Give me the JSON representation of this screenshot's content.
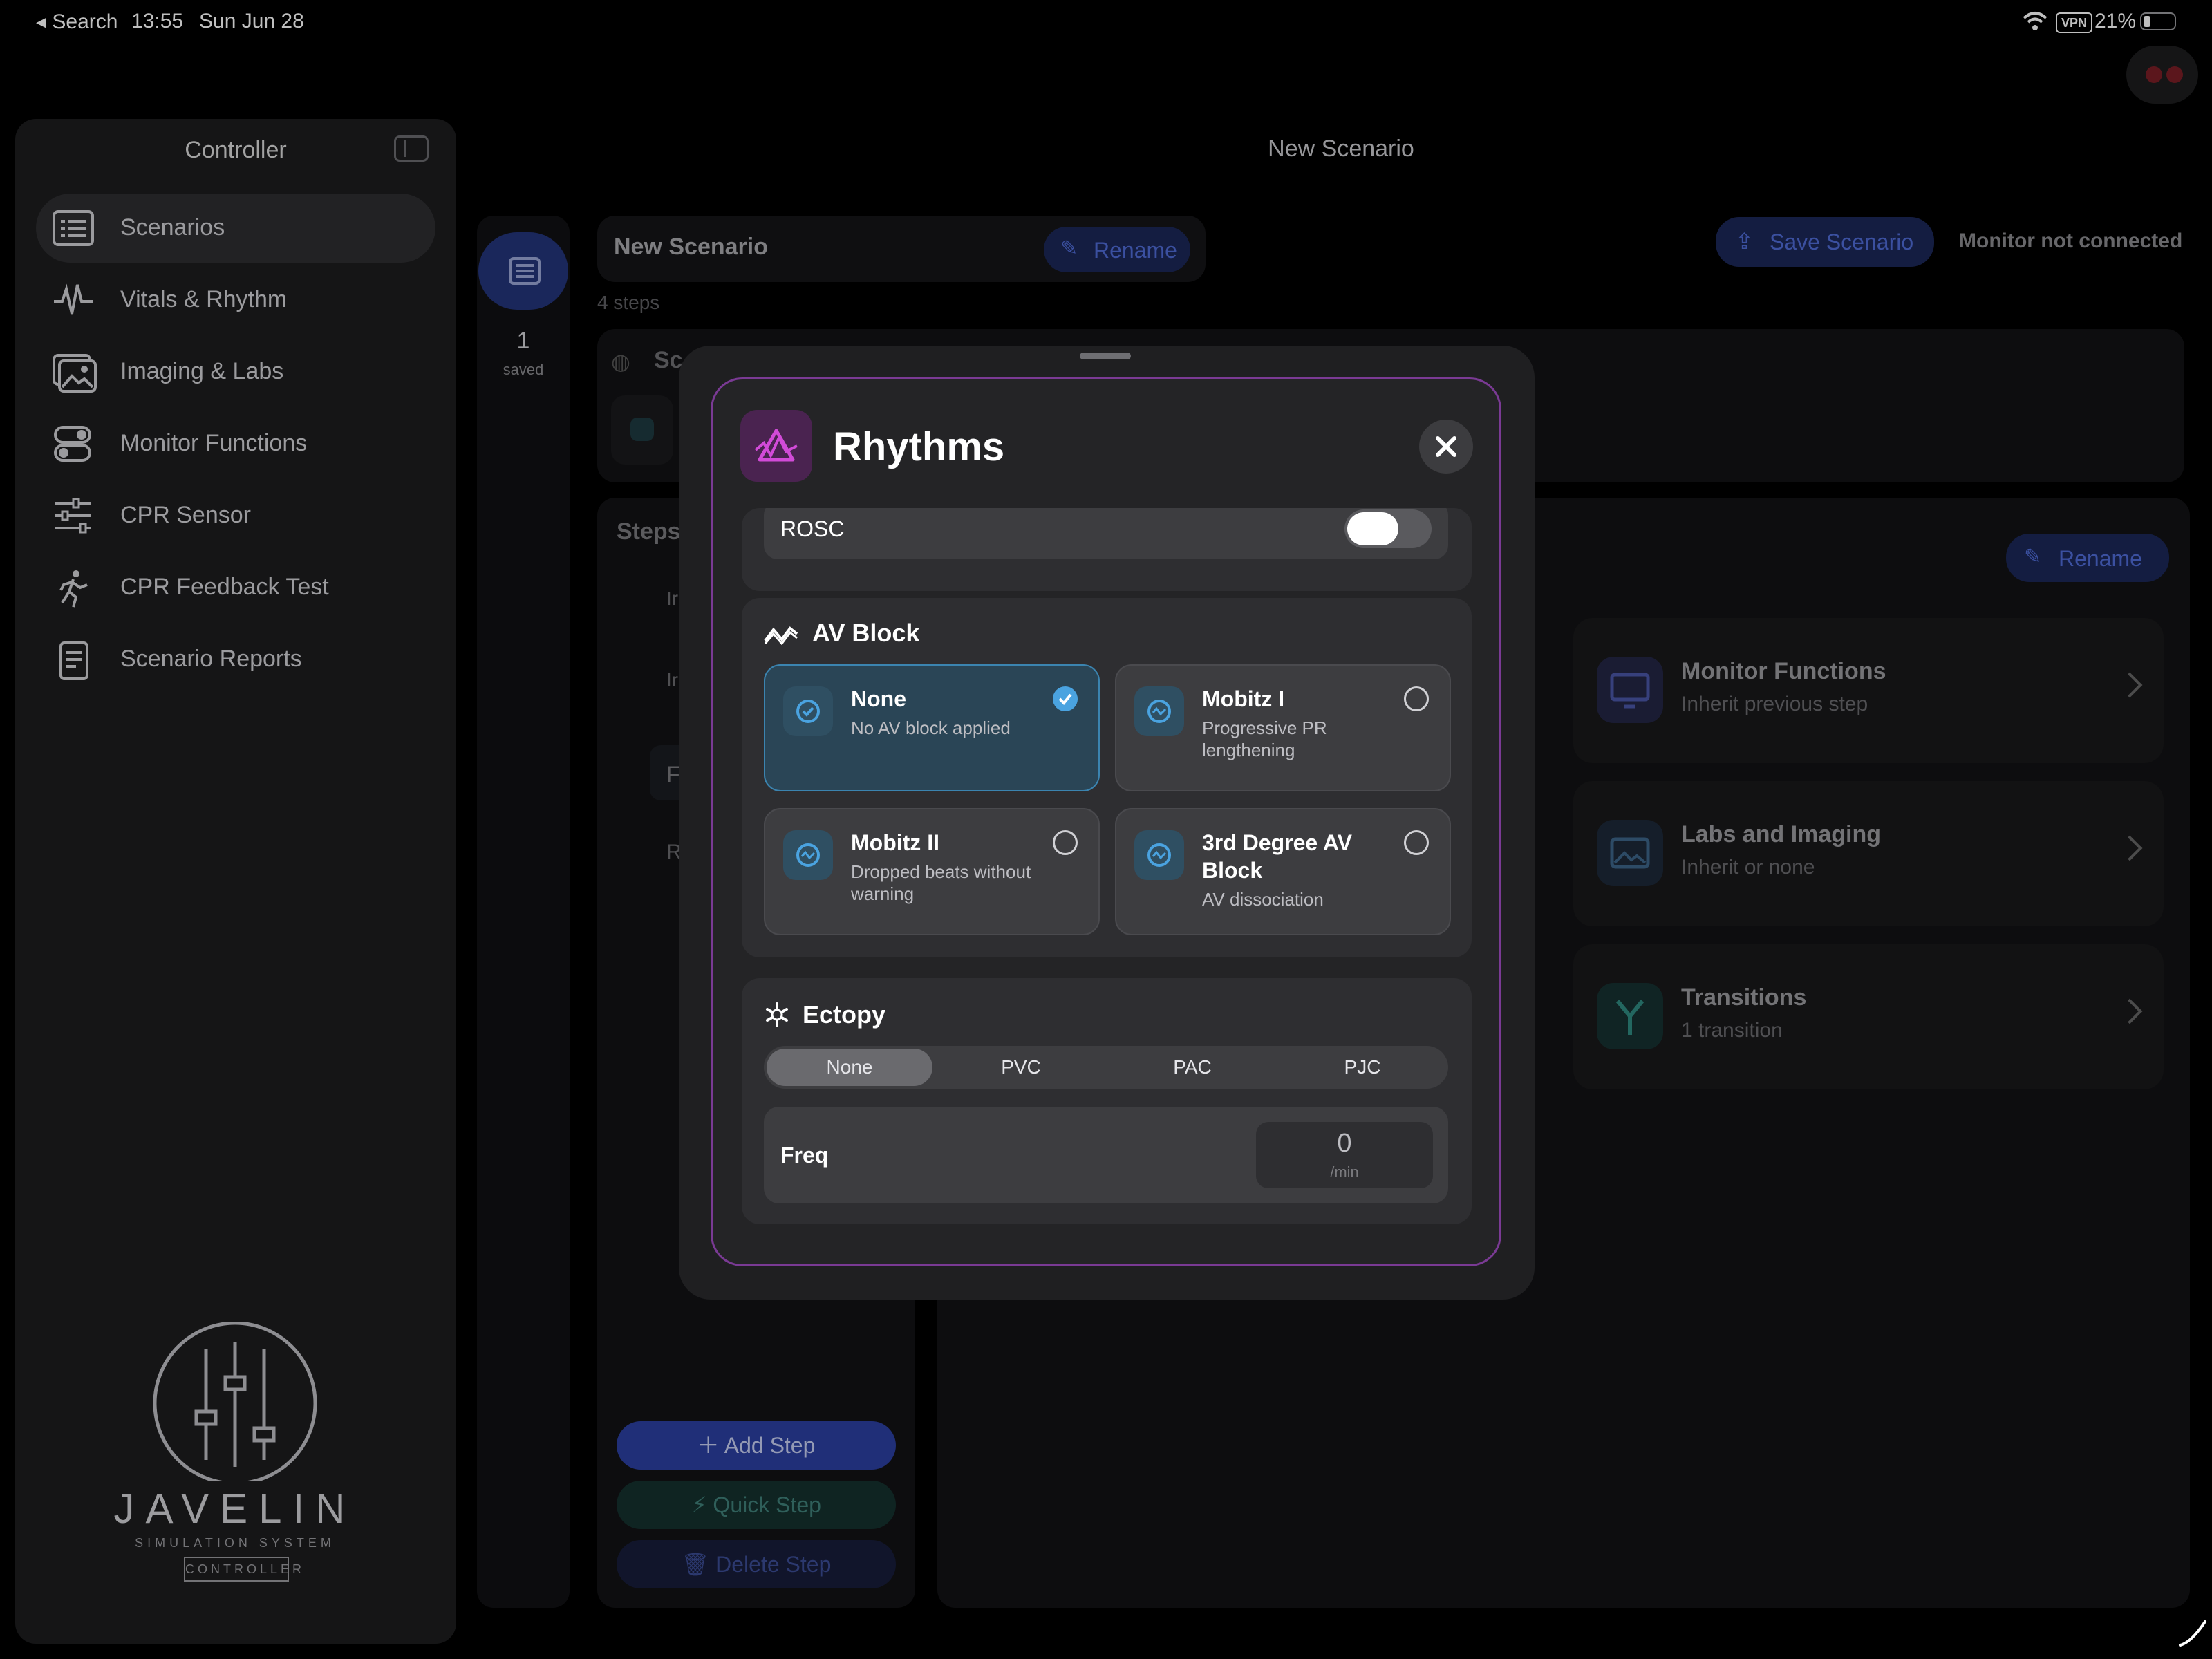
{
  "status_bar": {
    "back_label": "◂ Search",
    "time": "13:55",
    "date": "Sun Jun 28",
    "vpn": "VPN",
    "battery": "21%"
  },
  "sidebar": {
    "title": "Controller",
    "items": [
      {
        "label": "Scenarios",
        "selected": true
      },
      {
        "label": "Vitals & Rhythm"
      },
      {
        "label": "Imaging & Labs"
      },
      {
        "label": "Monitor Functions"
      },
      {
        "label": "CPR Sensor"
      },
      {
        "label": "CPR Feedback Test"
      },
      {
        "label": "Scenario Reports"
      }
    ],
    "logo": {
      "brand": "JAVELIN",
      "sub": "SIMULATION SYSTEM",
      "tag": "CONTROLLER"
    }
  },
  "main": {
    "title": "New Scenario",
    "rail": {
      "count": "1",
      "count_label": "saved"
    },
    "scenario_name": "New Scenario",
    "rename_label": "Rename",
    "steps_count": "4 steps",
    "save_label": "Save Scenario",
    "monitor_status": "Monitor not connected",
    "section_partial": "Sc",
    "steps_title": "Steps",
    "step_partials": [
      "Ir",
      "Ir",
      "F",
      "R"
    ],
    "step_rename_label": "Rename",
    "right_cards": [
      {
        "title": "Monitor Functions",
        "subtitle": "Inherit previous step"
      },
      {
        "title": "Labs and Imaging",
        "subtitle": "Inherit or none"
      },
      {
        "title": "Transitions",
        "subtitle": "1 transition"
      }
    ],
    "add_step": "Add Step",
    "quick_step": "Quick Step",
    "delete_step": "Delete Step"
  },
  "modal": {
    "title": "Rhythms",
    "rosc_label": "ROSC",
    "av_block": {
      "title": "AV Block",
      "options": [
        {
          "title": "None",
          "subtitle": "No AV block applied",
          "selected": true
        },
        {
          "title": "Mobitz I",
          "subtitle": "Progressive PR lengthening"
        },
        {
          "title": "Mobitz II",
          "subtitle": "Dropped beats without warning"
        },
        {
          "title": "3rd Degree AV Block",
          "subtitle": "AV dissociation"
        }
      ]
    },
    "ectopy": {
      "title": "Ectopy",
      "segments": [
        "None",
        "PVC",
        "PAC",
        "PJC"
      ],
      "selected": "None",
      "freq_label": "Freq",
      "freq_value": "0",
      "freq_unit": "/min"
    }
  },
  "colors": {
    "accent_blue": "#4f6bd6",
    "selection_blue": "#4aa3e0",
    "modal_border": "#7a3a94"
  }
}
